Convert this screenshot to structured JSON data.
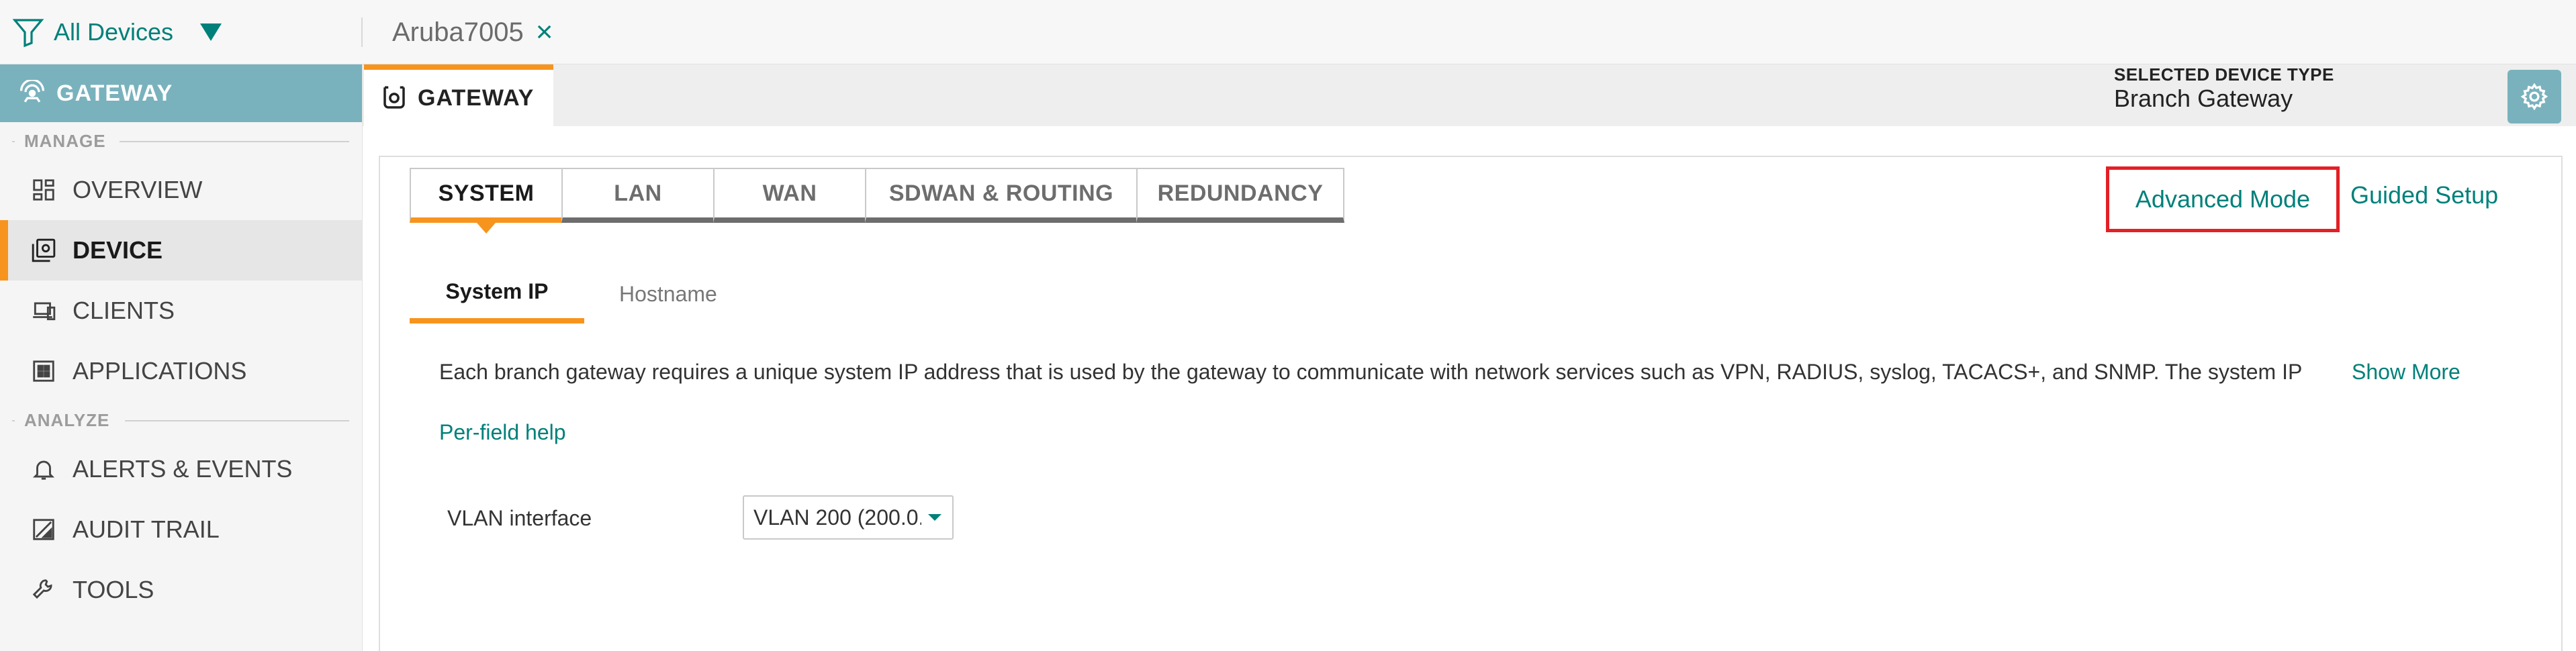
{
  "topbar": {
    "filter_icon": "funnel-icon",
    "filter_label": "All Devices",
    "device_tab_name": "Aruba7005",
    "close_icon": "close-icon"
  },
  "sidebar": {
    "header": {
      "icon": "gateway-icon",
      "label": "GATEWAY"
    },
    "sections": {
      "manage": "MANAGE",
      "analyze": "ANALYZE"
    },
    "items": [
      {
        "icon": "grid-icon",
        "label": "OVERVIEW"
      },
      {
        "icon": "device-icon",
        "label": "DEVICE",
        "active": true
      },
      {
        "icon": "clients-icon",
        "label": "CLIENTS"
      },
      {
        "icon": "applications-icon",
        "label": "APPLICATIONS"
      },
      {
        "icon": "bell-icon",
        "label": "ALERTS & EVENTS"
      },
      {
        "icon": "audit-icon",
        "label": "AUDIT TRAIL"
      },
      {
        "icon": "wrench-icon",
        "label": "TOOLS"
      }
    ]
  },
  "header": {
    "tab_label": "GATEWAY",
    "tab_icon": "gateway-device-icon",
    "selected_device_type_label": "SELECTED DEVICE TYPE",
    "selected_device_type_value": "Branch Gateway",
    "settings_icon": "gear-icon"
  },
  "main": {
    "tabs": [
      {
        "label": "SYSTEM",
        "active": true
      },
      {
        "label": "LAN"
      },
      {
        "label": "WAN"
      },
      {
        "label": "SDWAN & ROUTING"
      },
      {
        "label": "REDUNDANCY"
      }
    ],
    "advanced_mode": "Advanced Mode",
    "guided_setup": "Guided Setup",
    "subtabs": [
      {
        "label": "System IP",
        "active": true
      },
      {
        "label": "Hostname"
      }
    ],
    "description": "Each branch gateway requires a unique system IP address that is used by the gateway to communicate with network services such as VPN, RADIUS, syslog, TACACS+, and SNMP. The system IP",
    "show_more": "Show More",
    "per_field_help": "Per-field help",
    "vlan_label": "VLAN interface",
    "vlan_value": "VLAN 200 (200.0."
  },
  "colors": {
    "accent_teal": "#00807a",
    "active_orange": "#f7941d",
    "sidebar_header": "#79b2bd",
    "highlight_red": "#e41f26"
  }
}
